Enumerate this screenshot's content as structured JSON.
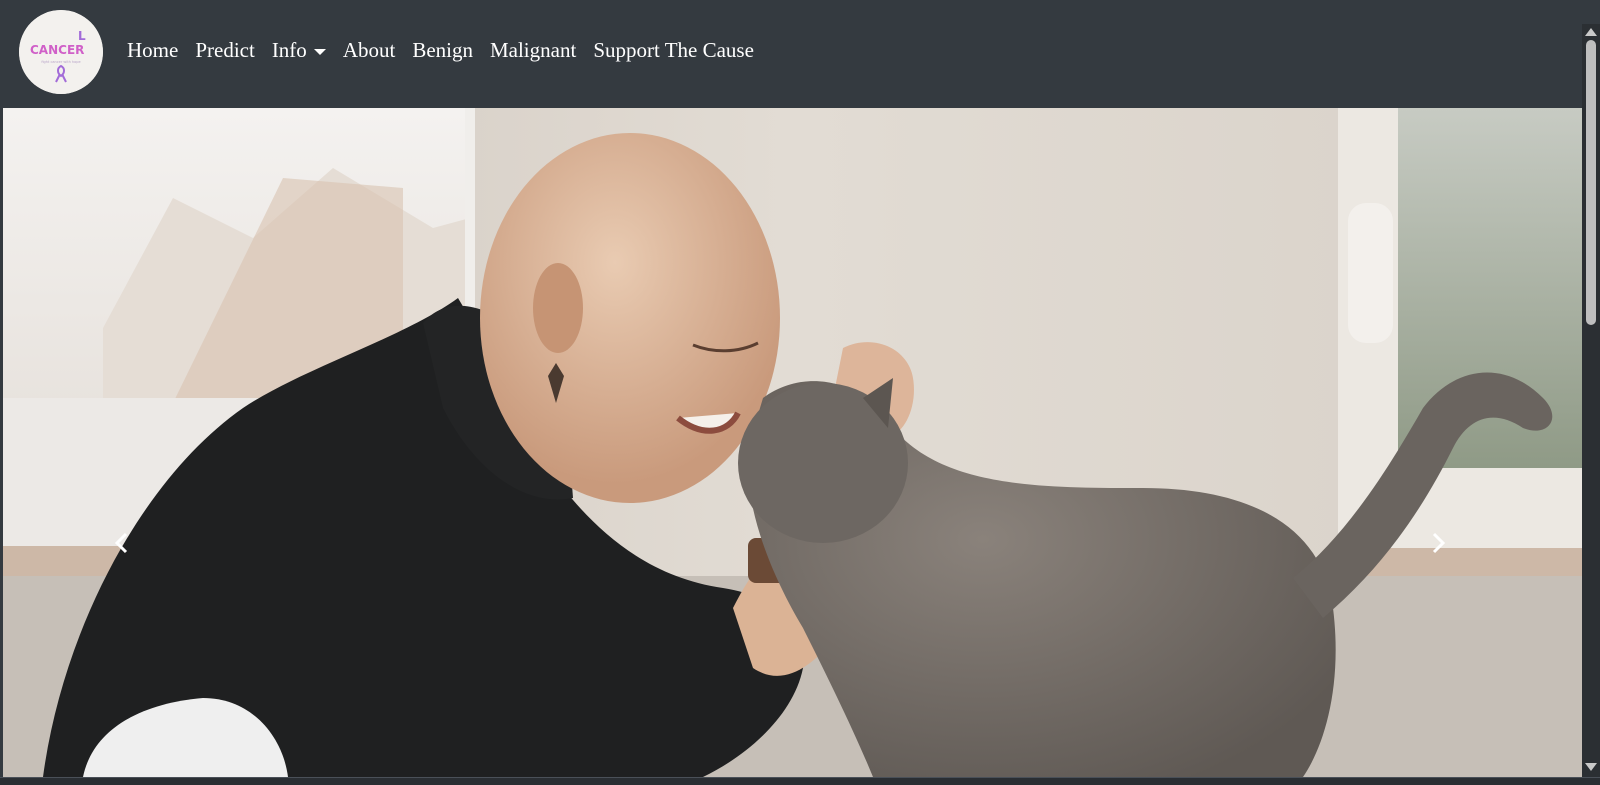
{
  "brand": {
    "logo_text": "CANCER",
    "logo_text_overlay": "L",
    "logo_tagline": "fight cancer with hope",
    "ribbon_color": "#a26bd8",
    "logo_text_color": "#d060c8"
  },
  "nav": {
    "items": [
      {
        "label": "Home"
      },
      {
        "label": "Predict"
      },
      {
        "label": "Info",
        "has_dropdown": true
      },
      {
        "label": "About"
      },
      {
        "label": "Benign"
      },
      {
        "label": "Malignant"
      },
      {
        "label": "Support The Cause"
      }
    ]
  },
  "carousel": {
    "prev_icon": "chevron-left-icon",
    "next_icon": "chevron-right-icon",
    "slide_image": "woman-with-cat-photo"
  },
  "colors": {
    "navbar_bg": "#343a40",
    "nav_text": "#ffffff"
  }
}
